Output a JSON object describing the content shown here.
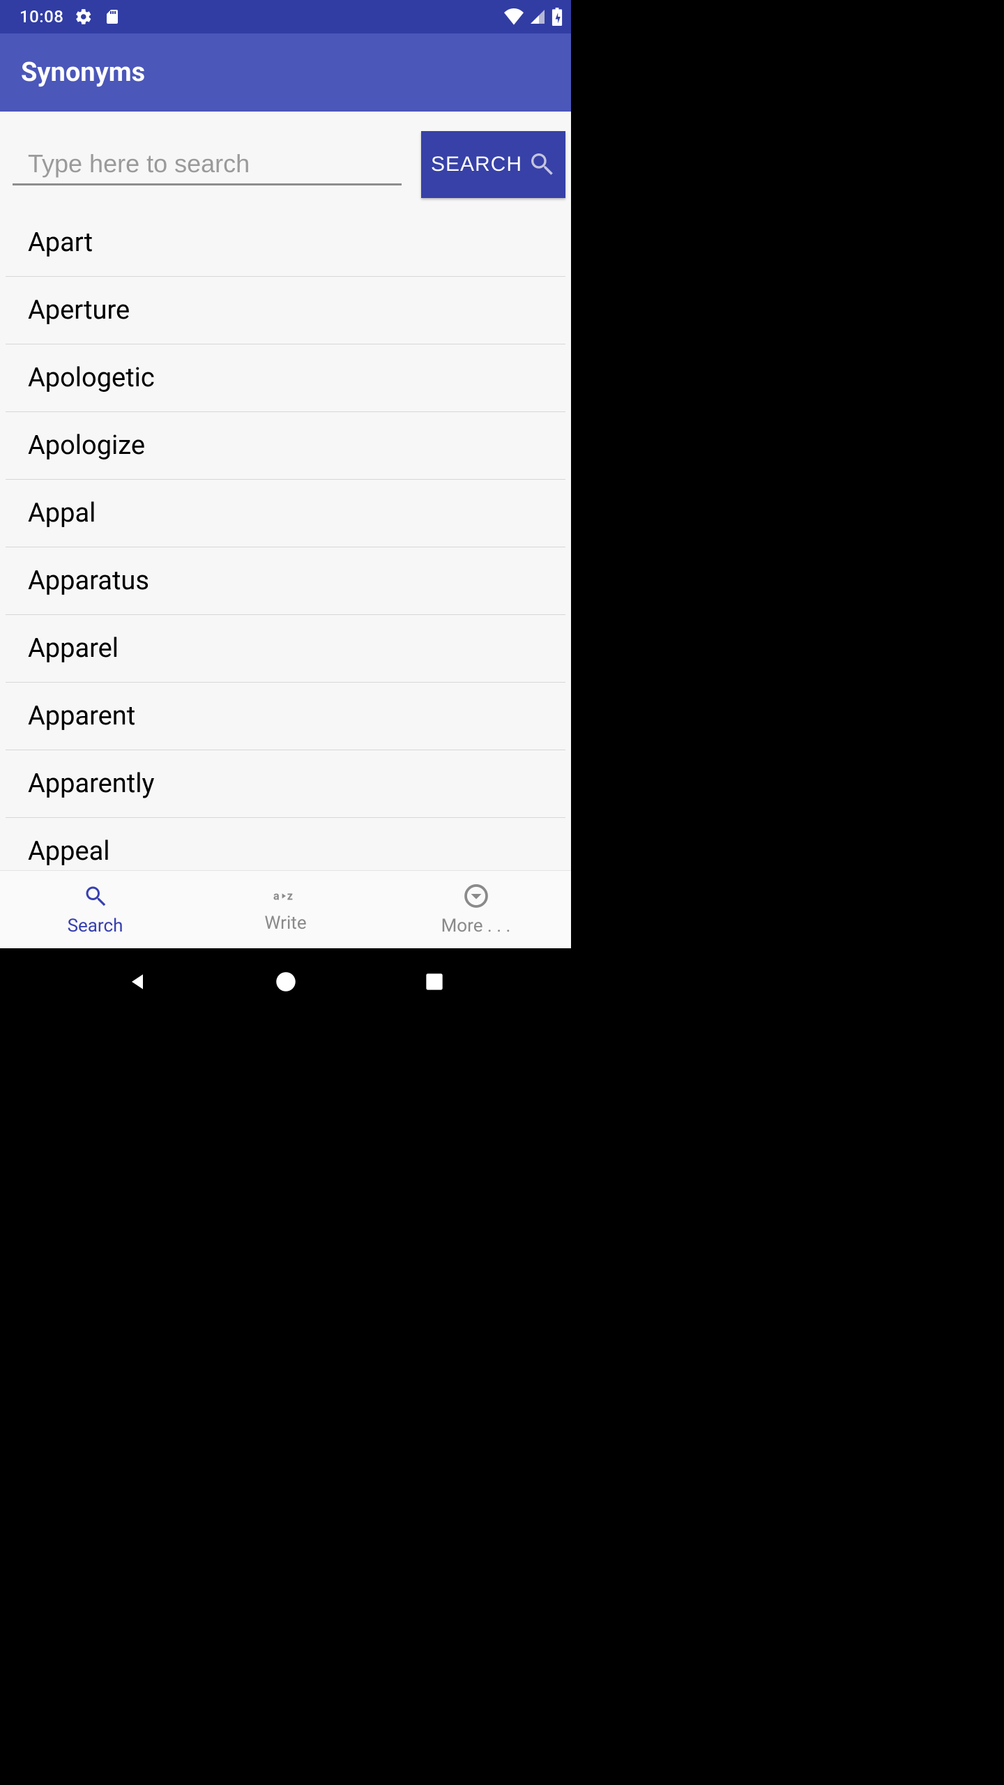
{
  "status": {
    "time": "10:08"
  },
  "app": {
    "title": "Synonyms"
  },
  "search": {
    "placeholder": "Type here to search",
    "button_label": "SEARCH"
  },
  "words": [
    {
      "label": "Apart"
    },
    {
      "label": "Aperture"
    },
    {
      "label": "Apologetic"
    },
    {
      "label": "Apologize"
    },
    {
      "label": "Appal"
    },
    {
      "label": "Apparatus"
    },
    {
      "label": "Apparel"
    },
    {
      "label": "Apparent"
    },
    {
      "label": "Apparently"
    },
    {
      "label": "Appeal"
    }
  ],
  "nav": {
    "search": "Search",
    "write": "Write",
    "more": "More . . ."
  }
}
